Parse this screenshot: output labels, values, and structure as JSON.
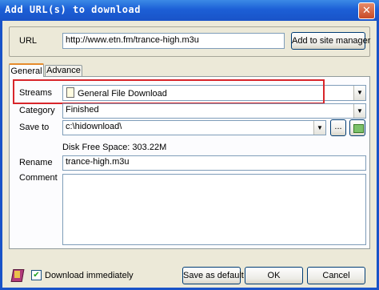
{
  "window": {
    "title": "Add URL(s) to download",
    "close_glyph": "✕"
  },
  "url": {
    "label": "URL",
    "value": "http://www.etn.fm/trance-high.m3u",
    "add_button": "Add to site manager"
  },
  "tabs": [
    {
      "label": "General"
    },
    {
      "label": "Advance"
    }
  ],
  "general": {
    "streams_label": "Streams",
    "streams_value": "General File Download",
    "category_label": "Category",
    "category_value": "Finished",
    "save_to_label": "Save to",
    "save_to_value": "c:\\hidownload\\",
    "browse_label": "...",
    "disk_free": "Disk Free Space: 303.22M",
    "rename_label": "Rename",
    "rename_value": "trance-high.m3u",
    "comment_label": "Comment",
    "comment_value": ""
  },
  "footer": {
    "download_immediately_label": "Download immediately",
    "download_immediately_checked": true,
    "check_glyph": "✔",
    "save_default": "Save as default",
    "ok": "OK",
    "cancel": "Cancel"
  },
  "icons": [
    "close-icon",
    "document-icon",
    "dropdown-arrow-icon",
    "folder-refresh-icon",
    "help-book-icon",
    "checkbox-icon"
  ]
}
